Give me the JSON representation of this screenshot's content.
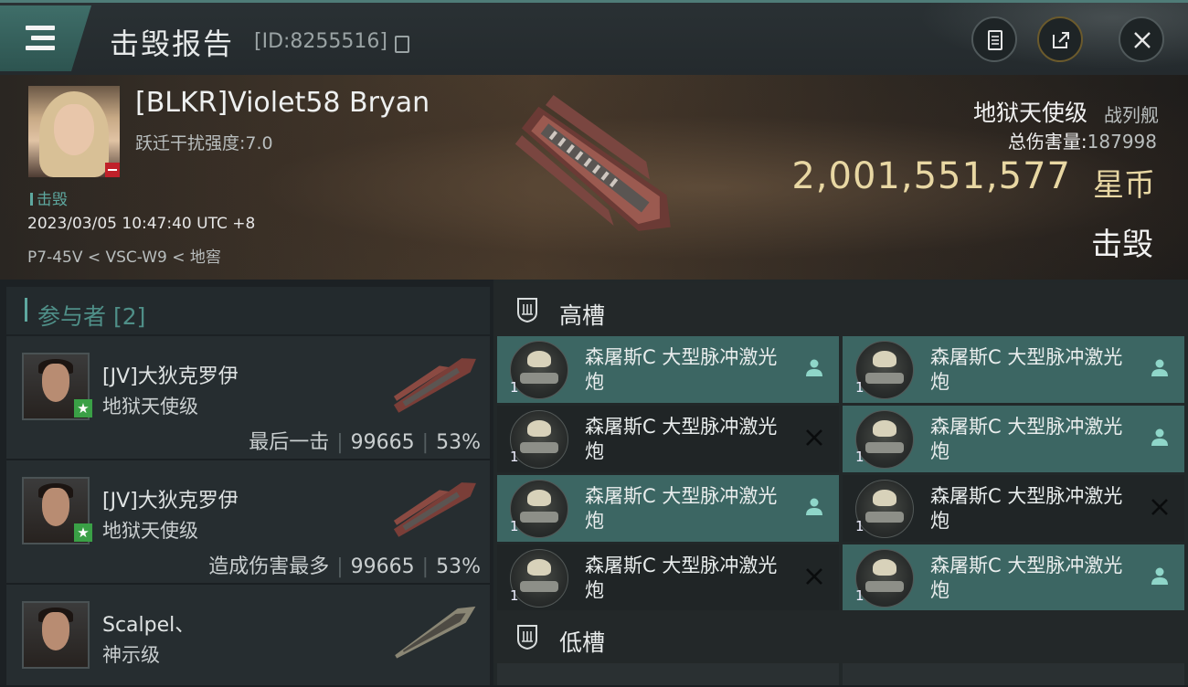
{
  "header": {
    "title": "击毁报告",
    "report_id": "[ID:8255516]"
  },
  "victim": {
    "name": "[BLKR]Violet58 Bryan",
    "warp_label": "跃迁干扰强度:",
    "warp_value": "7.0",
    "status": "击毁",
    "datetime": "2023/03/05 10:47:40 UTC +8",
    "location": "P7-45V < VSC-W9 < 地窖",
    "ship_name": "地狱天使级",
    "ship_class": "战列舰",
    "damage_label": "总伤害量:",
    "damage_value": "187998",
    "isk_value": "2,001,551,577",
    "isk_unit": "星币",
    "kill_label": "击毁"
  },
  "participants": {
    "header": "参与者 [2]",
    "items": [
      {
        "name": "[JV]大狄克罗伊",
        "ship": "地狱天使级",
        "tag": "最后一击",
        "damage": "99665",
        "percent": "53%"
      },
      {
        "name": "[JV]大狄克罗伊",
        "ship": "地狱天使级",
        "tag": "造成伤害最多",
        "damage": "99665",
        "percent": "53%"
      },
      {
        "name": "Scalpel、",
        "ship": "神示级"
      }
    ]
  },
  "fitting": {
    "high_slot_label": "高槽",
    "low_slot_label": "低槽",
    "modules": [
      {
        "qty": "1",
        "name": "森屠斯C 大型脉冲激光炮",
        "status": "fitted"
      },
      {
        "qty": "1",
        "name": "森屠斯C 大型脉冲激光炮",
        "status": "fitted"
      },
      {
        "qty": "1",
        "name": "森屠斯C 大型脉冲激光炮",
        "status": "destroyed"
      },
      {
        "qty": "1",
        "name": "森屠斯C 大型脉冲激光炮",
        "status": "fitted"
      },
      {
        "qty": "1",
        "name": "森屠斯C 大型脉冲激光炮",
        "status": "fitted"
      },
      {
        "qty": "1",
        "name": "森屠斯C 大型脉冲激光炮",
        "status": "destroyed"
      },
      {
        "qty": "1",
        "name": "森屠斯C 大型脉冲激光炮",
        "status": "destroyed"
      },
      {
        "qty": "1",
        "name": "森屠斯C 大型脉冲激光炮",
        "status": "fitted"
      }
    ]
  },
  "colors": {
    "accent": "#5ea89f",
    "fitted_bg": "#3c6663",
    "isk_gold": "#e8d7a3",
    "badge_red": "#c0212a",
    "badge_green": "#3aa046"
  }
}
